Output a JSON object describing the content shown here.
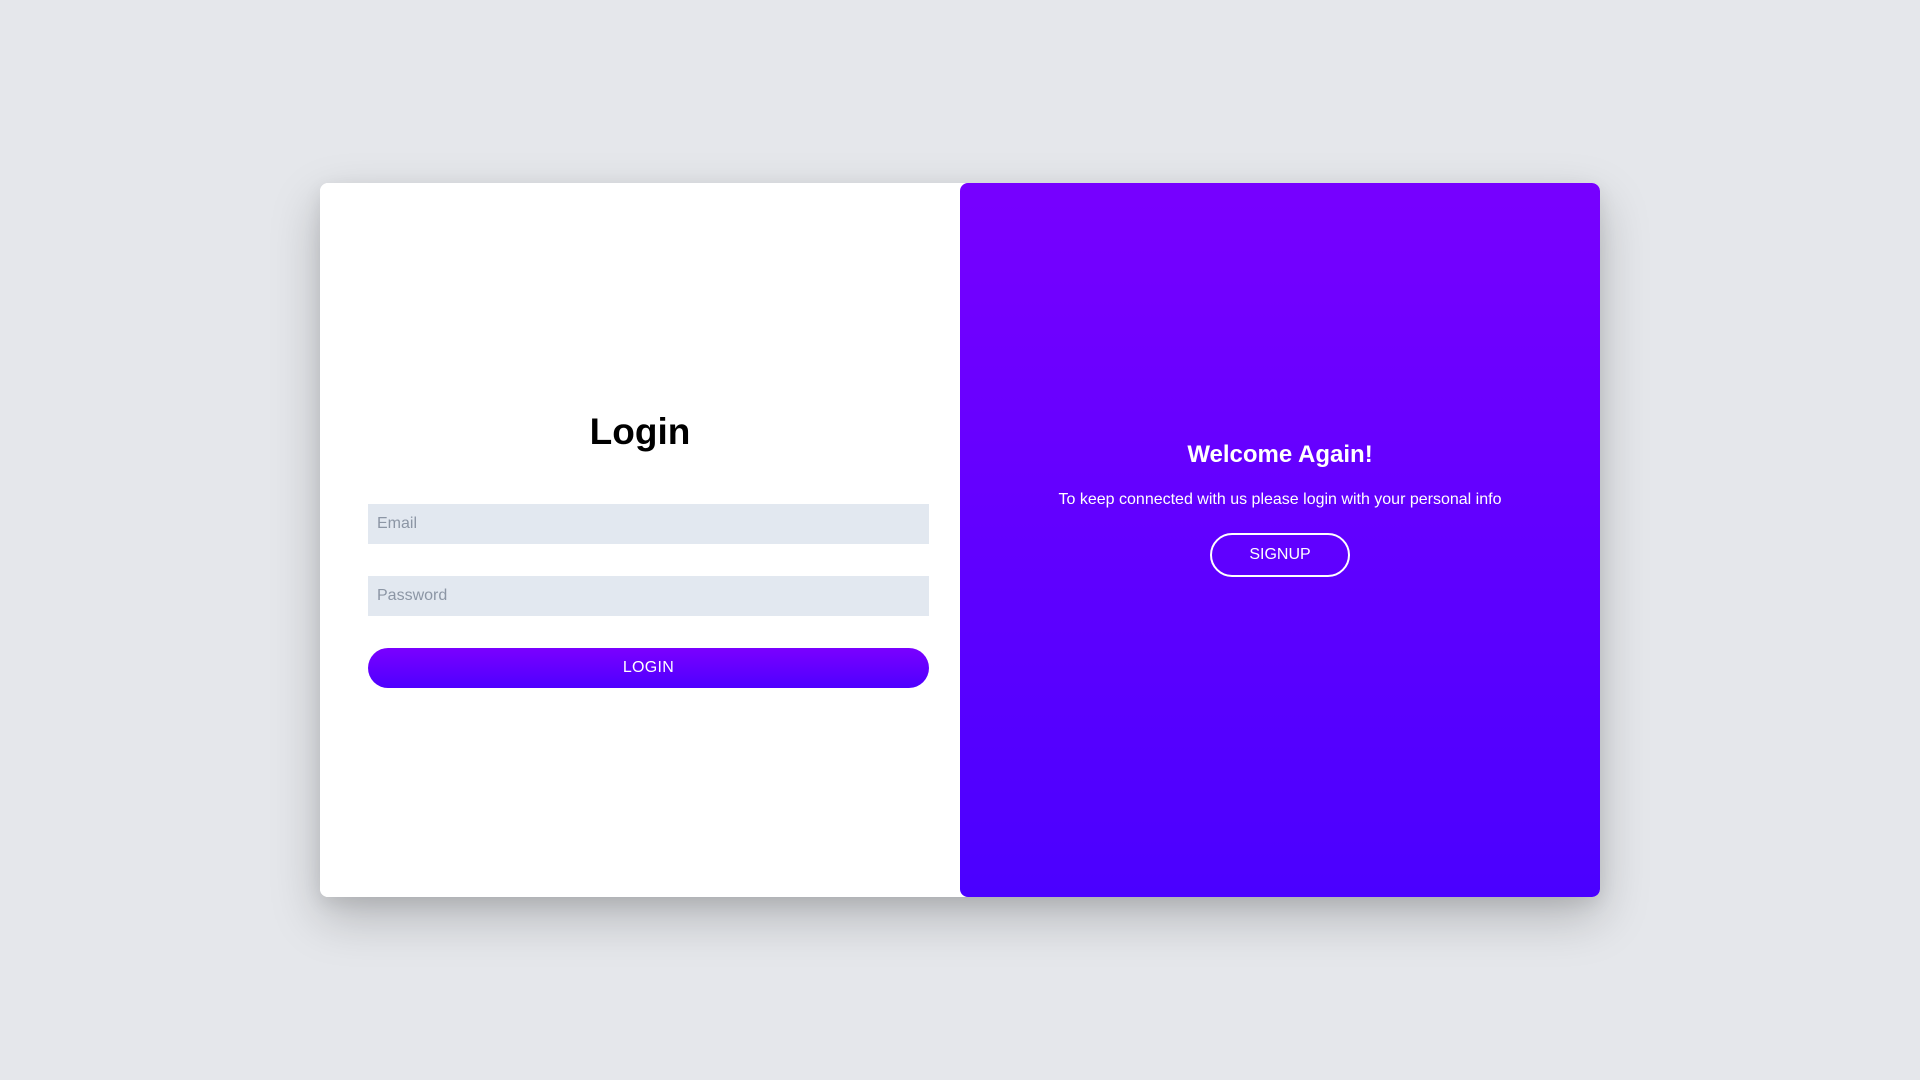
{
  "login": {
    "title": "Login",
    "email_placeholder": "Email",
    "email_value": "",
    "password_placeholder": "Password",
    "password_value": "",
    "button_label": "LOGIN"
  },
  "welcome": {
    "title": "Welcome Again!",
    "text": "To keep connected with us please login with your personal info",
    "button_label": "SIGNUP"
  },
  "colors": {
    "background": "#e5e7eb",
    "accent_gradient_start": "#7700ff",
    "accent_gradient_end": "#4a00ff",
    "input_background": "#e2e8f0"
  }
}
